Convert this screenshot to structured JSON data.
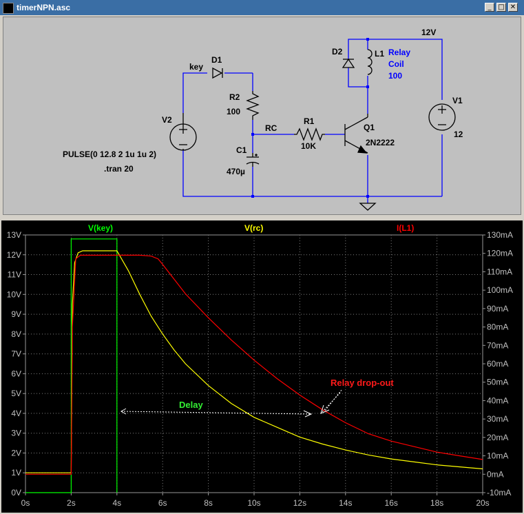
{
  "window": {
    "title": "timerNPN.asc",
    "buttons": {
      "minimize": "_",
      "maximize": "□",
      "close": "✕"
    }
  },
  "schematic": {
    "labels": {
      "key": "key",
      "d1": "D1",
      "r2": "R2",
      "r2_val": "100",
      "v2": "V2",
      "rc": "RC",
      "r1": "R1",
      "r1_val": "10K",
      "c1": "C1",
      "c1_val": "470µ",
      "q1": "Q1",
      "q1_val": "2N2222",
      "d2": "D2",
      "l1": "L1",
      "relay1": "Relay",
      "relay2": "Coil",
      "relay3": "100",
      "supply": "12V",
      "v1": "V1",
      "v1_val": "12",
      "pulse": "PULSE(0 12.8 2 1u 1u 2)",
      "tran": ".tran 20"
    },
    "colors": {
      "wire": "#0000ff",
      "component": "#000000",
      "annotation": "#0000ff"
    }
  },
  "plot": {
    "traces": [
      {
        "name": "V(key)",
        "color": "#00ff00"
      },
      {
        "name": "V(rc)",
        "color": "#ffff00"
      },
      {
        "name": "I(L1)",
        "color": "#ff0000"
      }
    ],
    "annotations": {
      "delay": "Delay",
      "dropout": "Relay drop-out"
    },
    "annotation_colors": {
      "delay": "#33ee33",
      "dropout": "#ff1a1a"
    }
  },
  "chart_data": {
    "type": "line",
    "x_tick_labels": [
      "0s",
      "2s",
      "4s",
      "6s",
      "8s",
      "10s",
      "12s",
      "14s",
      "16s",
      "18s",
      "20s"
    ],
    "y_left_tick_labels": [
      "0V",
      "1V",
      "2V",
      "3V",
      "4V",
      "5V",
      "6V",
      "7V",
      "8V",
      "9V",
      "10V",
      "11V",
      "12V",
      "13V"
    ],
    "y_right_tick_labels": [
      "-10mA",
      "0mA",
      "10mA",
      "20mA",
      "30mA",
      "40mA",
      "50mA",
      "60mA",
      "70mA",
      "80mA",
      "90mA",
      "100mA",
      "110mA",
      "120mA",
      "130mA"
    ],
    "xlim": [
      0,
      20
    ],
    "ylim_left": [
      0,
      13
    ],
    "ylim_right": [
      -10,
      130
    ],
    "grid": true,
    "series": [
      {
        "name": "V(key)",
        "axis": "left",
        "x": [
          0,
          2,
          2,
          4,
          4
        ],
        "y": [
          0,
          0,
          12.8,
          12.8,
          0
        ]
      },
      {
        "name": "V(rc)",
        "axis": "left",
        "x": [
          0,
          1.99,
          2.0,
          2.05,
          2.15,
          2.3,
          2.5,
          3,
          4,
          4.5,
          5,
          5.5,
          6,
          6.5,
          7,
          8,
          9,
          10,
          11,
          12,
          13,
          14,
          15,
          16,
          17,
          18,
          19,
          20
        ],
        "y": [
          1,
          1,
          1,
          9.5,
          11.6,
          12.1,
          12.2,
          12.2,
          12.2,
          11.2,
          10.0,
          8.9,
          8.0,
          7.2,
          6.5,
          5.4,
          4.5,
          3.8,
          3.3,
          2.8,
          2.45,
          2.15,
          1.9,
          1.7,
          1.55,
          1.4,
          1.3,
          1.2
        ]
      },
      {
        "name": "I(L1)",
        "axis": "right",
        "x": [
          0,
          2.0,
          2.05,
          2.2,
          2.4,
          3,
          4,
          5,
          5.5,
          5.8,
          6,
          6.5,
          7,
          8,
          9,
          10,
          11,
          12,
          13,
          14,
          15,
          16,
          17,
          18,
          19,
          20
        ],
        "y": [
          0,
          0,
          80,
          117,
          119,
          119,
          119,
          119,
          118.5,
          117,
          114,
          106,
          98,
          85,
          73,
          62,
          52,
          43,
          35,
          28,
          22,
          18,
          15,
          12,
          10,
          8
        ]
      }
    ]
  }
}
